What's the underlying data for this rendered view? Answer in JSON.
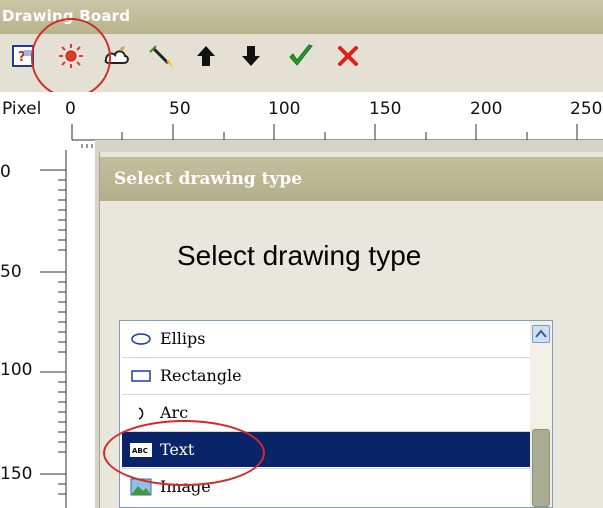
{
  "window": {
    "title": "Drawing Board"
  },
  "toolbar": {
    "items": [
      {
        "icon": "help-icon"
      },
      {
        "icon": "sun-icon"
      },
      {
        "icon": "cloud-icon"
      },
      {
        "icon": "brush-icon"
      },
      {
        "icon": "up-arrow-icon"
      },
      {
        "icon": "down-arrow-icon"
      },
      {
        "icon": "checkmark-icon"
      },
      {
        "icon": "close-icon"
      }
    ]
  },
  "ruler": {
    "unit_label": "Pixel",
    "h_ticks": [
      "0",
      "50",
      "100",
      "150",
      "200",
      "250"
    ],
    "v_ticks": [
      "0",
      "50",
      "100",
      "150"
    ]
  },
  "dialog": {
    "title": "Select drawing type",
    "heading": "Select drawing type",
    "items": [
      {
        "label": "Ellips",
        "icon": "ellipse-icon",
        "selected": false
      },
      {
        "label": "Rectangle",
        "icon": "rectangle-icon",
        "selected": false
      },
      {
        "label": "Arc",
        "icon": "arc-icon",
        "selected": false
      },
      {
        "label": "Text",
        "icon": "text-abc-icon",
        "selected": true
      },
      {
        "label": "Image",
        "icon": "image-icon",
        "selected": false
      }
    ]
  },
  "colors": {
    "selection": "#0a246a",
    "highlight_annotation": "#d42a2a",
    "titlebar": "#b7b58e"
  }
}
